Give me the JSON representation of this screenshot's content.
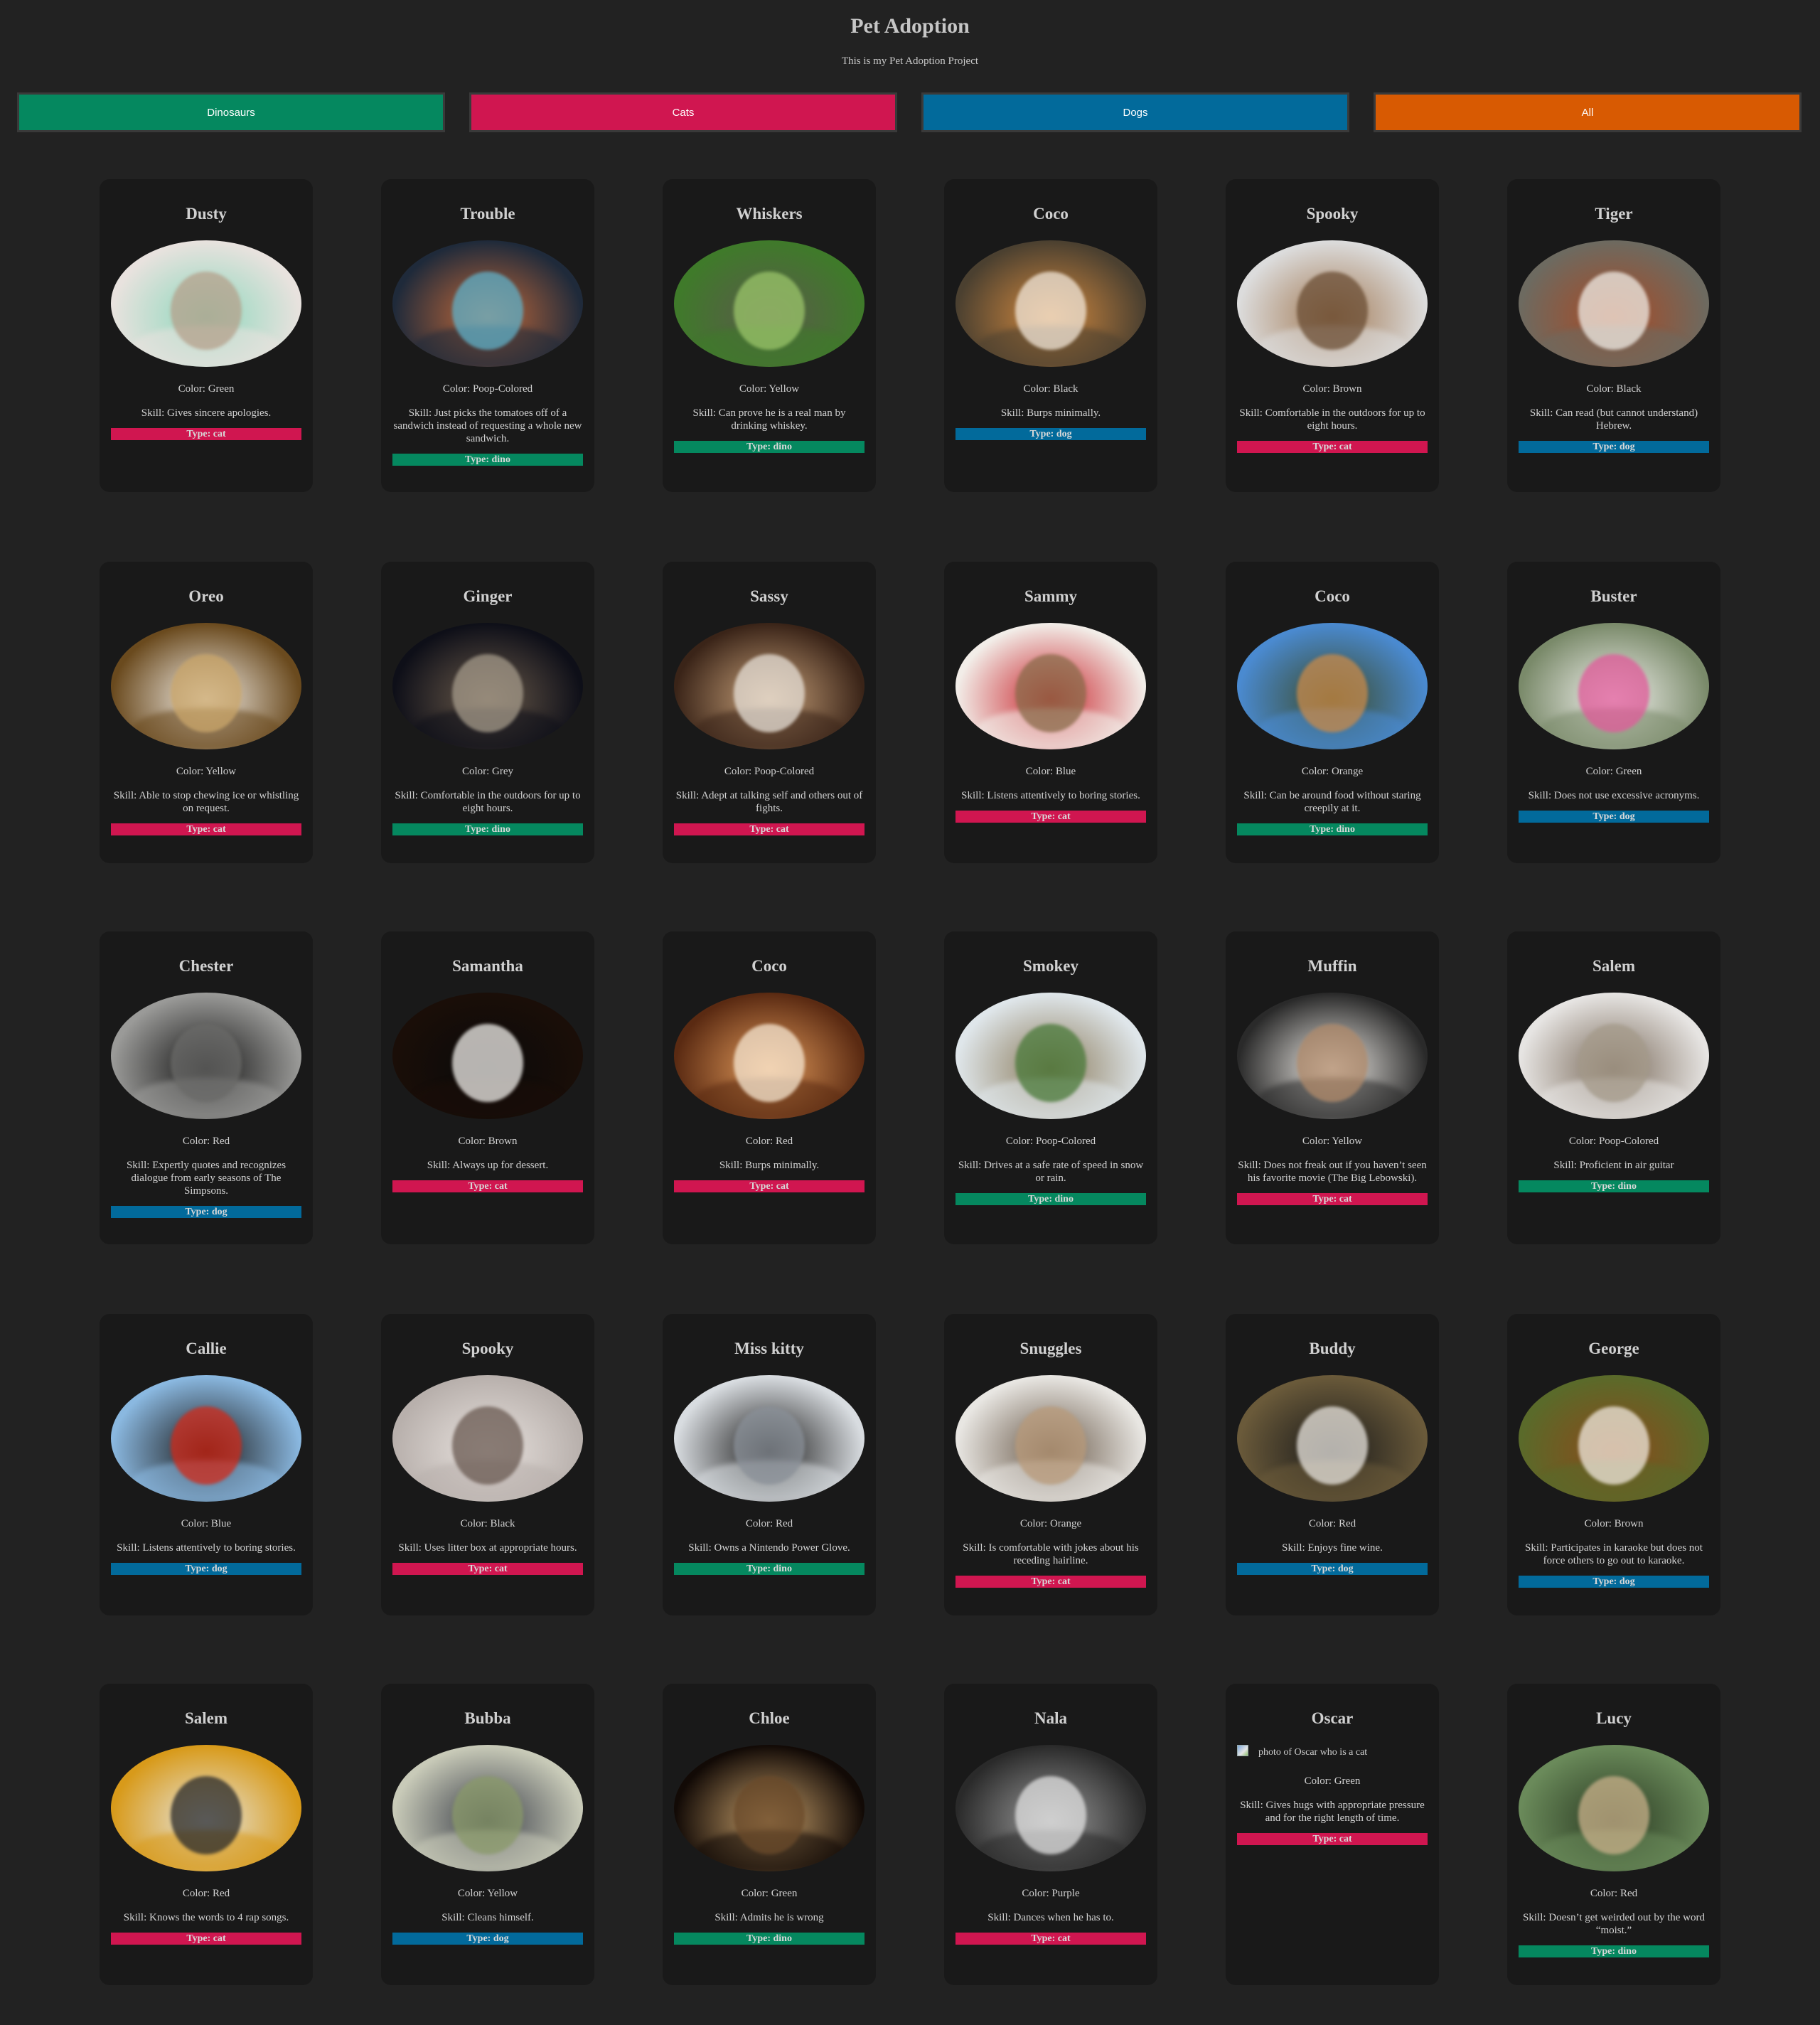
{
  "header": {
    "title": "Pet Adoption",
    "subtitle": "This is my Pet Adoption Project"
  },
  "filters": [
    {
      "label": "Dinosaurs",
      "color": "#05885f"
    },
    {
      "label": "Cats",
      "color": "#d01650"
    },
    {
      "label": "Dogs",
      "color": "#026a9b"
    },
    {
      "label": "All",
      "color": "#d85a02"
    }
  ],
  "type_colors": {
    "cat": "#d01650",
    "dino": "#05885f",
    "dog": "#026a9b"
  },
  "pets": [
    {
      "name": "Dusty",
      "color_text": "Color: Green",
      "skill_text": "Skill: Gives sincere apologies.",
      "type_text": "Type: cat",
      "type": "cat",
      "photo_colors": [
        "#e8e2de",
        "#8ed8bd",
        "#b5a08b"
      ]
    },
    {
      "name": "Trouble",
      "color_text": "Color: Poop-Colored",
      "skill_text": "Skill: Just picks the tomatoes off of a sandwich instead of requesting a whole new sandwich.",
      "type_text": "Type: dino",
      "type": "dino",
      "photo_colors": [
        "#1f2a3a",
        "#c46a3a",
        "#5fb0c8"
      ]
    },
    {
      "name": "Whiskers",
      "color_text": "Color: Yellow",
      "skill_text": "Skill: Can prove he is a real man by drinking whiskey.",
      "type_text": "Type: dino",
      "type": "dino",
      "photo_colors": [
        "#3f7a2a",
        "#5a5a4a",
        "#9bc66a"
      ]
    },
    {
      "name": "Coco",
      "color_text": "Color: Black",
      "skill_text": "Skill: Burps minimally.",
      "type_text": "Type: dog",
      "type": "dog",
      "photo_colors": [
        "#4b4030",
        "#d48a3f",
        "#f1e6d8"
      ]
    },
    {
      "name": "Spooky",
      "color_text": "Color: Brown",
      "skill_text": "Skill: Comfortable in the outdoors for up to eight hours.",
      "type_text": "Type: cat",
      "type": "cat",
      "photo_colors": [
        "#dcdcdc",
        "#a27a55",
        "#6b4e34"
      ]
    },
    {
      "name": "Tiger",
      "color_text": "Color: Black",
      "skill_text": "Skill: Can read (but cannot understand) Hebrew.",
      "type_text": "Type: dog",
      "type": "dog",
      "photo_colors": [
        "#6d6a60",
        "#a84a25",
        "#f0ece6"
      ]
    },
    {
      "name": "Oreo",
      "color_text": "Color: Yellow",
      "skill_text": "Skill: Able to stop chewing ice or whistling on request.",
      "type_text": "Type: cat",
      "type": "cat",
      "photo_colors": [
        "#6a4a1e",
        "#f3eee7",
        "#caa66a"
      ]
    },
    {
      "name": "Ginger",
      "color_text": "Color: Grey",
      "skill_text": "Skill: Comfortable in the outdoors for up to eight hours.",
      "type_text": "Type: dino",
      "type": "dino",
      "photo_colors": [
        "#0e0f18",
        "#6a5a4a",
        "#a49a8a"
      ]
    },
    {
      "name": "Sassy",
      "color_text": "Color: Poop-Colored",
      "skill_text": "Skill: Adept at talking self and others out of fights.",
      "type_text": "Type: cat",
      "type": "cat",
      "photo_colors": [
        "#3a2418",
        "#c9a27a",
        "#e6dfd6"
      ]
    },
    {
      "name": "Sammy",
      "color_text": "Color: Blue",
      "skill_text": "Skill: Listens attentively to boring stories.",
      "type_text": "Type: cat",
      "type": "cat",
      "photo_colors": [
        "#f2ede8",
        "#c8232b",
        "#8a6b4a"
      ]
    },
    {
      "name": "Coco",
      "color_text": "Color: Orange",
      "skill_text": "Skill: Can be around food without staring creepily at it.",
      "type_text": "Type: dino",
      "type": "dino",
      "photo_colors": [
        "#4a8ad0",
        "#3a4a2a",
        "#c88a4a"
      ]
    },
    {
      "name": "Buster",
      "color_text": "Color: Green",
      "skill_text": "Skill: Does not use excessive acronyms.",
      "type_text": "Type: dog",
      "type": "dog",
      "photo_colors": [
        "#7a8a6a",
        "#f2f2ee",
        "#e05a9a"
      ]
    },
    {
      "name": "Chester",
      "color_text": "Color: Red",
      "skill_text": "Skill: Expertly quotes and recognizes dialogue from early seasons of The Simpsons.",
      "type_text": "Type: dog",
      "type": "dog",
      "photo_colors": [
        "#9a9a98",
        "#141414",
        "#6a6a68"
      ]
    },
    {
      "name": "Samantha",
      "color_text": "Color: Brown",
      "skill_text": "Skill: Always up for dessert.",
      "type_text": "Type: cat",
      "type": "cat",
      "photo_colors": [
        "#1a0e08",
        "#0a0a0a",
        "#f0eeea"
      ]
    },
    {
      "name": "Coco",
      "color_text": "Color: Red",
      "skill_text": "Skill: Burps minimally.",
      "type_text": "Type: cat",
      "type": "cat",
      "photo_colors": [
        "#5a2a12",
        "#e29a5a",
        "#f6e6d0"
      ]
    },
    {
      "name": "Smokey",
      "color_text": "Color: Poop-Colored",
      "skill_text": "Skill: Drives at a safe rate of speed in snow or rain.",
      "type_text": "Type: dino",
      "type": "dino",
      "photo_colors": [
        "#dfe6ea",
        "#8a7a5a",
        "#4a7a3a"
      ]
    },
    {
      "name": "Muffin",
      "color_text": "Color: Yellow",
      "skill_text": "Skill: Does not freak out if you haven’t seen his favorite movie (The Big Lebowski).",
      "type_text": "Type: cat",
      "type": "cat",
      "photo_colors": [
        "#2a2a2a",
        "#f0ede8",
        "#b08a6a"
      ]
    },
    {
      "name": "Salem",
      "color_text": "Color: Poop-Colored",
      "skill_text": "Skill: Proficient in air guitar",
      "type_text": "Type: dino",
      "type": "dino",
      "photo_colors": [
        "#e6e4e2",
        "#7a6a5a",
        "#a49a8a"
      ]
    },
    {
      "name": "Callie",
      "color_text": "Color: Blue",
      "skill_text": "Skill: Listens attentively to boring stories.",
      "type_text": "Type: dog",
      "type": "dog",
      "photo_colors": [
        "#8ab8e0",
        "#1a1a1a",
        "#d02a1a"
      ]
    },
    {
      "name": "Spooky",
      "color_text": "Color: Black",
      "skill_text": "Skill: Uses litter box at appropriate hours.",
      "type_text": "Type: cat",
      "type": "cat",
      "photo_colors": [
        "#b8b0ac",
        "#e8e2de",
        "#6a5a52"
      ]
    },
    {
      "name": "Miss kitty",
      "color_text": "Color: Red",
      "skill_text": "Skill: Owns a Nintendo Power Glove.",
      "type_text": "Type: dino",
      "type": "dino",
      "photo_colors": [
        "#d8dce0",
        "#1a1a1a",
        "#8a9098"
      ]
    },
    {
      "name": "Snuggles",
      "color_text": "Color: Orange",
      "skill_text": "Skill: Is comfortable with jokes about his receding hairline.",
      "type_text": "Type: cat",
      "type": "cat",
      "photo_colors": [
        "#e8e6e2",
        "#6a5a4a",
        "#b89a7a"
      ]
    },
    {
      "name": "Buddy",
      "color_text": "Color: Red",
      "skill_text": "Skill: Enjoys fine wine.",
      "type_text": "Type: dog",
      "type": "dog",
      "photo_colors": [
        "#6a5a3a",
        "#1a1a1a",
        "#e8e4de"
      ]
    },
    {
      "name": "George",
      "color_text": "Color: Brown",
      "skill_text": "Skill: Participates in karaoke but does not force others to go out to karaoke.",
      "type_text": "Type: dog",
      "type": "dog",
      "photo_colors": [
        "#5a6a2a",
        "#8a4a1a",
        "#f0e8de"
      ]
    },
    {
      "name": "Salem",
      "color_text": "Color: Red",
      "skill_text": "Skill: Knows the words to 4 rap songs.",
      "type_text": "Type: cat",
      "type": "cat",
      "photo_colors": [
        "#d89a1a",
        "#e6e6e0",
        "#2a2a2a"
      ]
    },
    {
      "name": "Bubba",
      "color_text": "Color: Yellow",
      "skill_text": "Skill: Cleans himself.",
      "type_text": "Type: dog",
      "type": "dog",
      "photo_colors": [
        "#c8cab8",
        "#3a3e48",
        "#8a9a6a"
      ]
    },
    {
      "name": "Chloe",
      "color_text": "Color: Green",
      "skill_text": "Skill: Admits he is wrong",
      "type_text": "Type: dino",
      "type": "dino",
      "photo_colors": [
        "#120a06",
        "#c8a06a",
        "#6a4a2a"
      ]
    },
    {
      "name": "Nala",
      "color_text": "Color: Purple",
      "skill_text": "Skill: Dances when he has to.",
      "type_text": "Type: cat",
      "type": "cat",
      "photo_colors": [
        "#2a2a2a",
        "#9a9a9a",
        "#e0e0e0"
      ]
    },
    {
      "name": "Oscar",
      "color_text": "Color: Green",
      "skill_text": "Skill: Gives hugs with appropriate pressure and for the right length of time.",
      "type_text": "Type: cat",
      "type": "cat",
      "photo_alt": "photo of Oscar who is a cat",
      "photo_broken": true
    },
    {
      "name": "Lucy",
      "color_text": "Color: Red",
      "skill_text": "Skill: Doesn’t get weirded out by the word “moist.”",
      "type_text": "Type: dino",
      "type": "dino",
      "photo_colors": [
        "#6a8a5a",
        "#2a3a22",
        "#c8b08a"
      ]
    }
  ]
}
